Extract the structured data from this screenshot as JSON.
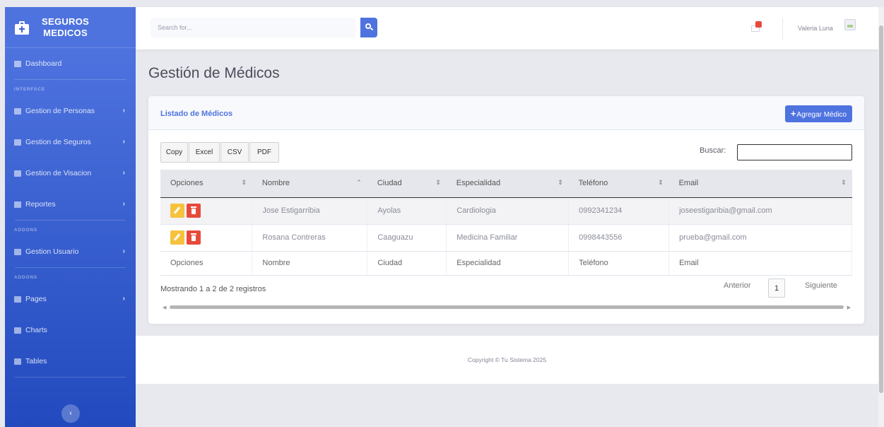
{
  "brand": {
    "line1": "SEGUROS",
    "line2": "MEDICOS"
  },
  "sidebar": {
    "dashboard": "Dashboard",
    "heading_interface": "INTERFACE",
    "personas": "Gestion de Personas",
    "seguros": "Gestion de Seguros",
    "visacion": "Gestion de Visacion",
    "reportes": "Reportes",
    "heading_addons1": "ADDONS",
    "usuario": "Gestion Usuario",
    "heading_addons2": "ADDONS",
    "pages": "Pages",
    "charts": "Charts",
    "tables": "Tables",
    "chevron": "›",
    "toggle": "‹"
  },
  "topbar": {
    "search_placeholder": "Search for...",
    "user_name": "Valeria Luna"
  },
  "page_title": "Gestión de Médicos",
  "card": {
    "title": "Listado de Médicos",
    "add_label": "Agregar Médico",
    "add_plus": "+"
  },
  "export_buttons": {
    "copy": "Copy",
    "excel": "Excel",
    "csv": "CSV",
    "pdf": "PDF"
  },
  "filter": {
    "label": "Buscar:"
  },
  "table": {
    "headers": [
      "Opciones",
      "Nombre",
      "Ciudad",
      "Especialidad",
      "Teléfono",
      "Email"
    ],
    "sort_icons": [
      "⇕",
      "⌃",
      "⇕",
      "⇕",
      "⇕",
      "⇕"
    ],
    "rows": [
      {
        "nombre": "Jose Estigarribia",
        "ciudad": "Ayolas",
        "especialidad": "Cardiologia",
        "telefono": "0992341234",
        "email": "joseestigaribia@gmail.com"
      },
      {
        "nombre": "Rosana Contreras",
        "ciudad": "Caaguazu",
        "especialidad": "Medicina Familiar",
        "telefono": "0998443556",
        "email": "prueba@gmail.com"
      }
    ],
    "footers": [
      "Opciones",
      "Nombre",
      "Ciudad",
      "Especialidad",
      "Teléfono",
      "Email"
    ]
  },
  "pagination": {
    "info": "Mostrando 1 a 2 de 2 registros",
    "prev": "Anterior",
    "page": "1",
    "next": "Siguiente"
  },
  "footer": {
    "copyright": "Copyright © Tu Sistema 2025"
  },
  "colors": {
    "primary": "#4e73df",
    "warning": "#f6c23e",
    "danger": "#e74a3b"
  },
  "icons": {
    "brand": "medkit-icon",
    "dashboard": "tachometer-icon",
    "personas": "user-icon",
    "seguros": "file-icon",
    "visacion": "credit-card-icon",
    "reportes": "book-icon",
    "usuario": "users-icon",
    "pages": "folder-icon",
    "charts": "chart-area-icon",
    "tables": "table-icon",
    "search": "search-icon",
    "messages": "envelope-icon",
    "edit": "pencil-icon",
    "delete": "trash-icon"
  }
}
